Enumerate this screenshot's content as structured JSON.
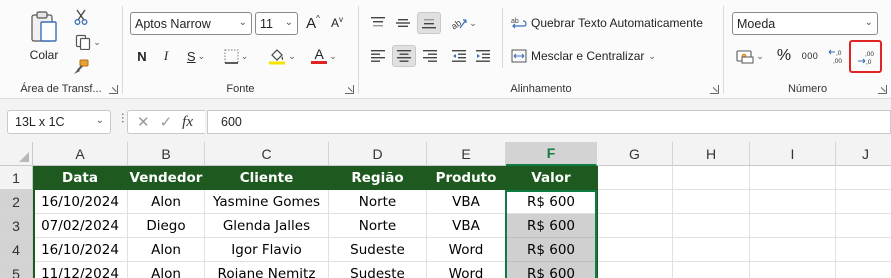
{
  "ribbon": {
    "clipboard": {
      "paste_label": "Colar",
      "group_label": "Área de Transf..."
    },
    "font": {
      "font_name": "Aptos Narrow",
      "font_size": "11",
      "bold_label": "N",
      "italic_label": "I",
      "underline_label": "S",
      "grow_label": "A",
      "shrink_label": "A",
      "font_color_label": "A",
      "group_label": "Fonte"
    },
    "alignment": {
      "wrap_text_label": "Quebrar Texto Automaticamente",
      "merge_center_label": "Mesclar e Centralizar",
      "group_label": "Alinhamento"
    },
    "number": {
      "format_value": "Moeda",
      "percent_label": "%",
      "thousands_label": "000",
      "group_label": "Número",
      "highlight_color": "#e02424"
    }
  },
  "formula_bar": {
    "name_box": "13L x 1C",
    "formula": "600"
  },
  "grid": {
    "columns": [
      "A",
      "B",
      "C",
      "D",
      "E",
      "F",
      "G",
      "H",
      "I",
      "J"
    ],
    "rows": [
      "1",
      "2",
      "3",
      "4",
      "5"
    ],
    "table_header": [
      "Data",
      "Vendedor",
      "Cliente",
      "Região",
      "Produto",
      "Valor"
    ],
    "table_rows": [
      [
        "16/10/2024",
        "Alon",
        "Yasmine Gomes",
        "Norte",
        "VBA",
        "R$ 600"
      ],
      [
        "07/02/2024",
        "Diego",
        "Glenda Jalles",
        "Norte",
        "VBA",
        "R$ 600"
      ],
      [
        "16/10/2024",
        "Alon",
        "Igor Flavio",
        "Sudeste",
        "Word",
        "R$ 600"
      ],
      [
        "11/12/2024",
        "Alon",
        "Roiane Nemitz",
        "Sudeste",
        "Word",
        "R$ 600"
      ]
    ],
    "header_color": "#1e5a1f",
    "selection_color": "#107c41"
  }
}
